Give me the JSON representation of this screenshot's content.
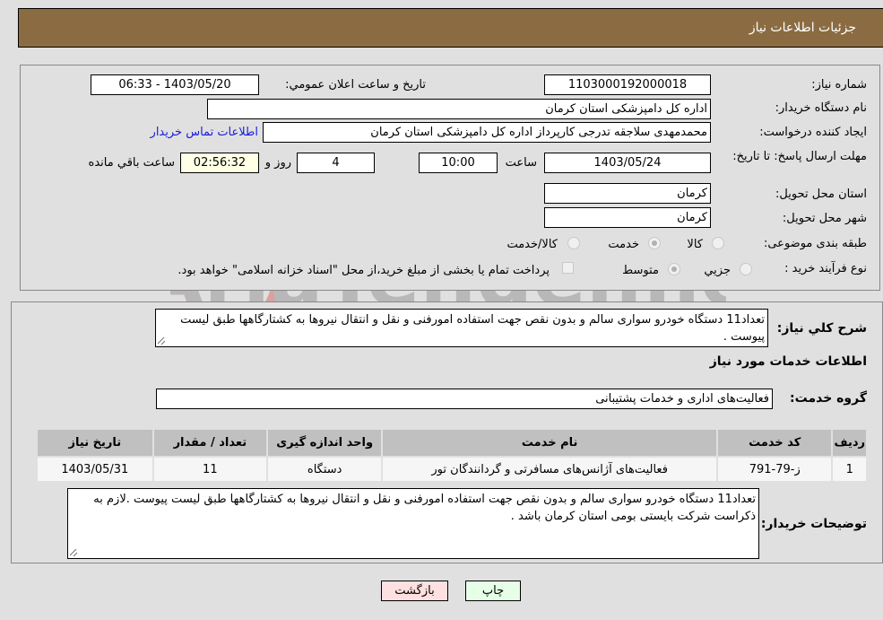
{
  "header": {
    "title": "جزئیات اطلاعات نیاز"
  },
  "details": {
    "need_number_label": "شماره نیاز:",
    "need_number": "1103000192000018",
    "announce_label": "تاريخ و ساعت اعلان عمومي:",
    "announce_value": "1403/05/20 - 06:33",
    "buyer_org_label": "نام دستگاه خریدار:",
    "buyer_org": "اداره کل دامپزشکی استان کرمان",
    "creator_label": "ایجاد کننده درخواست:",
    "creator": "محمدمهدی سلاجقه تدرجی کارپرداز اداره کل دامپزشکی استان کرمان",
    "contact_link": "اطلاعات تماس خریدار",
    "deadline_label": "مهلت ارسال پاسخ: تا تاریخ:",
    "deadline_date": "1403/05/24",
    "time_label": "ساعت",
    "deadline_time": "10:00",
    "days_value": "4",
    "days_label": "روز و",
    "remaining_time": "02:56:32",
    "remaining_label": "ساعت باقي مانده",
    "province_label": "استان محل تحویل:",
    "province": "کرمان",
    "city_label": "شهر محل تحویل:",
    "city": "کرمان",
    "category_label": "طبقه بندی موضوعی:",
    "category_options": [
      {
        "label": "کالا",
        "checked": false
      },
      {
        "label": "خدمت",
        "checked": true
      },
      {
        "label": "کالا/خدمت",
        "checked": false
      }
    ],
    "process_label": "نوع فرآیند خرید :",
    "process_options": [
      {
        "label": "جزيي",
        "checked": false
      },
      {
        "label": "متوسط",
        "checked": true
      }
    ],
    "treasury_note": "پرداخت تمام یا بخشی از مبلغ خرید،از محل \"اسناد خزانه اسلامی\" خواهد بود.",
    "treasury_checked": false
  },
  "summary": {
    "label": "شرح کلي نياز:",
    "text": "تعداد11 دستگاه خودرو سواری سالم و بدون نقص جهت استفاده امورفنی و نقل و انتقال نیروها به کشتارگاهها طبق لیست پیوست ."
  },
  "services": {
    "section_title": "اطلاعات خدمات مورد نیاز",
    "group_label": "گروه خدمت:",
    "group_value": "فعالیت‌های اداری و خدمات پشتیبانی",
    "table": {
      "headers": [
        "ردیف",
        "کد خدمت",
        "نام خدمت",
        "واحد اندازه گیری",
        "تعداد / مقدار",
        "تاریخ نیاز"
      ],
      "rows": [
        [
          "1",
          "ز-79-791",
          "فعالیت‌های آژانس‌های مسافرتی و گردانندگان تور",
          "دستگاه",
          "11",
          "1403/05/31"
        ]
      ]
    },
    "buyer_notes_label": "توضیحات خریدار:",
    "buyer_notes": "تعداد11 دستگاه خودرو سواری سالم و بدون نقص جهت استفاده امورفنی و نقل و انتقال نیروها به کشتارگاهها طبق لیست پیوست .لازم به ذکراست شرکت بایستی بومی استان کرمان باشد ."
  },
  "buttons": {
    "print": "چاپ",
    "back": "بازگشت"
  },
  "watermark": {
    "text": "AriaTender.neT"
  },
  "colors": {
    "header_bg": "#8b6c42",
    "link": "#1a1adc",
    "back_btn": "#ffe0e0",
    "print_btn": "#e6ffe6",
    "remaining_bg": "#ffffe6"
  }
}
